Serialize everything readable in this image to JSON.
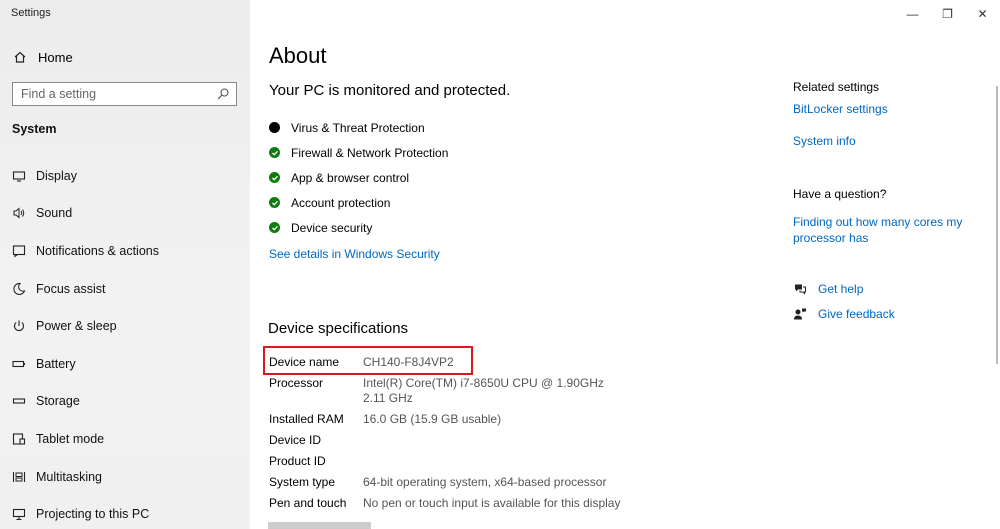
{
  "window": {
    "title": "Settings",
    "controls": {
      "minimize": "—",
      "restore": "❐",
      "close": "✕"
    }
  },
  "sidebar": {
    "home_label": "Home",
    "search": {
      "placeholder": "Find a setting"
    },
    "section_label": "System",
    "items": [
      {
        "label": "Display",
        "icon": "display-icon"
      },
      {
        "label": "Sound",
        "icon": "speaker-icon"
      },
      {
        "label": "Notifications & actions",
        "icon": "notification-icon"
      },
      {
        "label": "Focus assist",
        "icon": "moon-icon"
      },
      {
        "label": "Power & sleep",
        "icon": "power-icon"
      },
      {
        "label": "Battery",
        "icon": "battery-icon"
      },
      {
        "label": "Storage",
        "icon": "storage-icon"
      },
      {
        "label": "Tablet mode",
        "icon": "tablet-icon"
      },
      {
        "label": "Multitasking",
        "icon": "multitasking-icon"
      },
      {
        "label": "Projecting to this PC",
        "icon": "projector-icon"
      }
    ]
  },
  "main": {
    "title": "About",
    "protection": {
      "title": "Your PC is monitored and protected.",
      "items": [
        {
          "label": "Virus & Threat Protection",
          "status": "black"
        },
        {
          "label": "Firewall & Network Protection",
          "status": "ok"
        },
        {
          "label": "App & browser control",
          "status": "ok"
        },
        {
          "label": "Account protection",
          "status": "ok"
        },
        {
          "label": "Device security",
          "status": "ok"
        }
      ],
      "details_link": "See details in Windows Security"
    },
    "specs": {
      "title": "Device specifications",
      "rows": [
        {
          "key": "Device name",
          "value": "CH140-F8J4VP2"
        },
        {
          "key": "Processor",
          "value": "Intel(R) Core(TM) i7-8650U CPU @ 1.90GHz   2.11 GHz"
        },
        {
          "key": "Installed RAM",
          "value": "16.0 GB (15.9 GB usable)"
        },
        {
          "key": "Device ID",
          "value": ""
        },
        {
          "key": "Product ID",
          "value": ""
        },
        {
          "key": "System type",
          "value": "64-bit operating system, x64-based processor"
        },
        {
          "key": "Pen and touch",
          "value": "No pen or touch input is available for this display"
        }
      ]
    }
  },
  "right": {
    "related_title": "Related settings",
    "bitlocker_link": "BitLocker settings",
    "sysinfo_link": "System info",
    "question_title": "Have a question?",
    "cores_link": "Finding out how many cores my processor has",
    "get_help": "Get help",
    "give_feedback": "Give feedback"
  },
  "colors": {
    "accent": "#0067c0",
    "ok": "#107c10",
    "highlight": "#d71920"
  }
}
